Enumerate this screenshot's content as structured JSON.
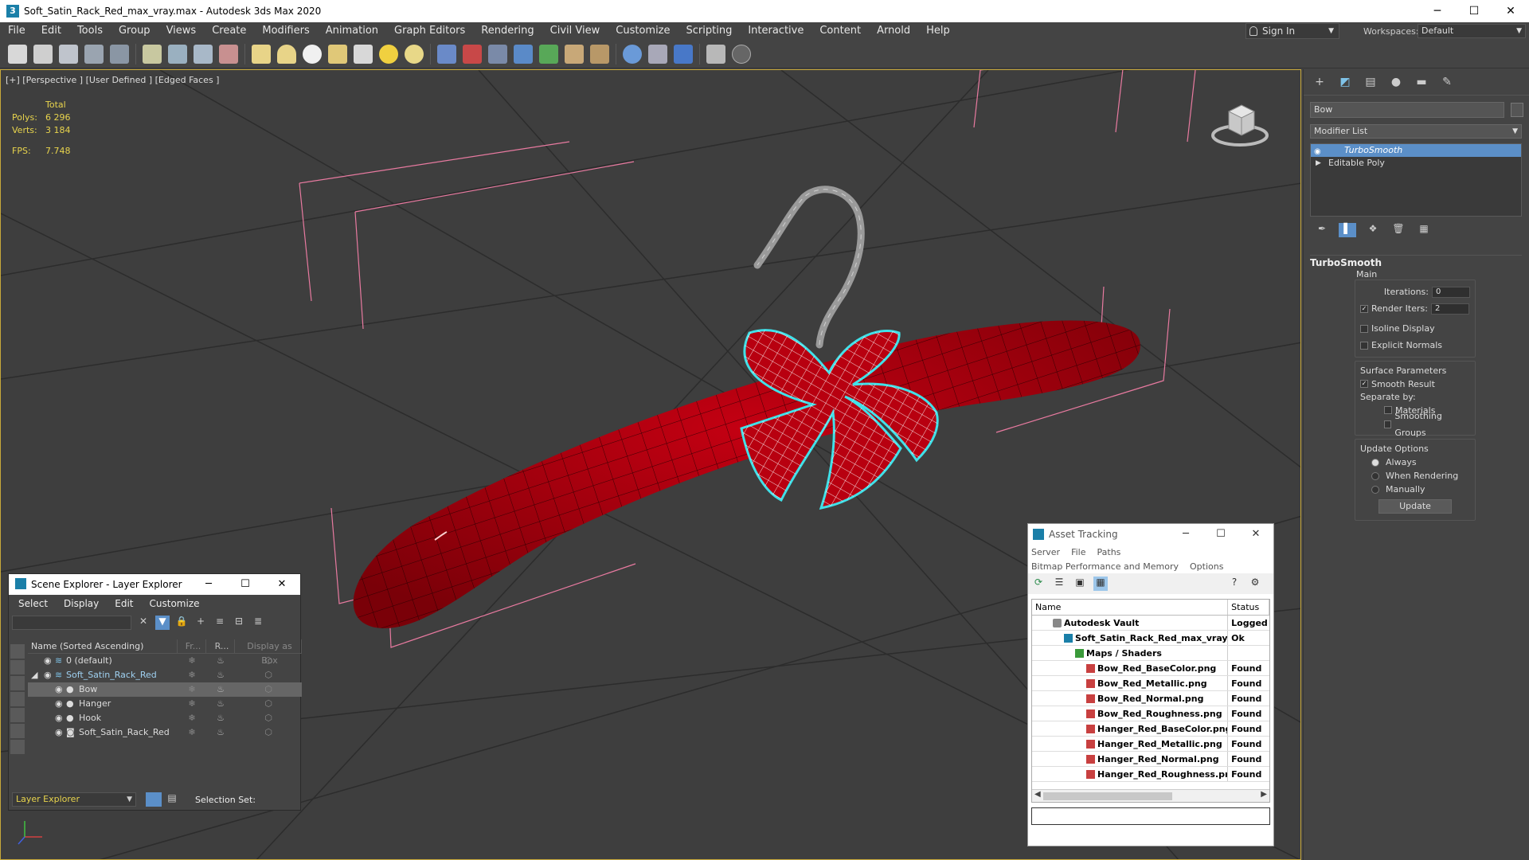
{
  "window": {
    "title": "Soft_Satin_Rack_Red_max_vray.max - Autodesk 3ds Max 2020",
    "min": "─",
    "max": "☐",
    "close": "✕"
  },
  "menu": [
    "File",
    "Edit",
    "Tools",
    "Group",
    "Views",
    "Create",
    "Modifiers",
    "Animation",
    "Graph Editors",
    "Rendering",
    "Civil View",
    "Customize",
    "Scripting",
    "Interactive",
    "Content",
    "Arnold",
    "Help"
  ],
  "signin": "Sign In",
  "workspaces": {
    "label": "Workspaces:",
    "value": "Default"
  },
  "viewport": {
    "label": "[+] [Perspective ] [User Defined ] [Edged Faces ]",
    "stats": {
      "total": "Total",
      "polys_label": "Polys:",
      "polys": "6 296",
      "verts_label": "Verts:",
      "verts": "3 184",
      "fps_label": "FPS:",
      "fps": "7.748"
    }
  },
  "command_panel": {
    "object_name": "Bow",
    "modifier_list": "Modifier List",
    "stack": [
      "TurboSmooth",
      "Editable Poly"
    ],
    "rollout": {
      "title": "TurboSmooth",
      "main": "Main",
      "iterations_label": "Iterations:",
      "iterations": "0",
      "render_iters_label": "Render Iters:",
      "render_iters": "2",
      "isoline": "Isoline Display",
      "explicit_normals": "Explicit Normals",
      "surface_params": "Surface Parameters",
      "smooth_result": "Smooth Result",
      "separate_by": "Separate by:",
      "materials": "Materials",
      "smoothing_groups": "Smoothing Groups",
      "update_options": "Update Options",
      "always": "Always",
      "when_rendering": "When Rendering",
      "manually": "Manually",
      "update": "Update"
    }
  },
  "scene_explorer": {
    "title": "Scene Explorer - Layer Explorer",
    "menu": [
      "Select",
      "Display",
      "Edit",
      "Customize"
    ],
    "columns": [
      "Name (Sorted Ascending)",
      "Fr...",
      "R...",
      "Display as Box"
    ],
    "rows": [
      {
        "name": "0 (default)",
        "indent": 0
      },
      {
        "name": "Soft_Satin_Rack_Red",
        "indent": 0
      },
      {
        "name": "Bow",
        "indent": 1
      },
      {
        "name": "Hanger",
        "indent": 1
      },
      {
        "name": "Hook",
        "indent": 1
      },
      {
        "name": "Soft_Satin_Rack_Red",
        "indent": 1
      }
    ],
    "layer_explorer": "Layer Explorer",
    "selection_set": "Selection Set:"
  },
  "asset_tracking": {
    "title": "Asset Tracking",
    "menu1": [
      "Server",
      "File",
      "Paths"
    ],
    "menu2": [
      "Bitmap Performance and Memory",
      "Options"
    ],
    "columns": [
      "Name",
      "Status"
    ],
    "rows": [
      {
        "name": "Autodesk Vault",
        "status": "Logged O"
      },
      {
        "name": "Soft_Satin_Rack_Red_max_vray.max",
        "status": "Ok"
      },
      {
        "name": "Maps / Shaders",
        "status": ""
      },
      {
        "name": "Bow_Red_BaseColor.png",
        "status": "Found"
      },
      {
        "name": "Bow_Red_Metallic.png",
        "status": "Found"
      },
      {
        "name": "Bow_Red_Normal.png",
        "status": "Found"
      },
      {
        "name": "Bow_Red_Roughness.png",
        "status": "Found"
      },
      {
        "name": "Hanger_Red_BaseColor.png",
        "status": "Found"
      },
      {
        "name": "Hanger_Red_Metallic.png",
        "status": "Found"
      },
      {
        "name": "Hanger_Red_Normal.png",
        "status": "Found"
      },
      {
        "name": "Hanger_Red_Roughness.png",
        "status": "Found"
      }
    ]
  }
}
